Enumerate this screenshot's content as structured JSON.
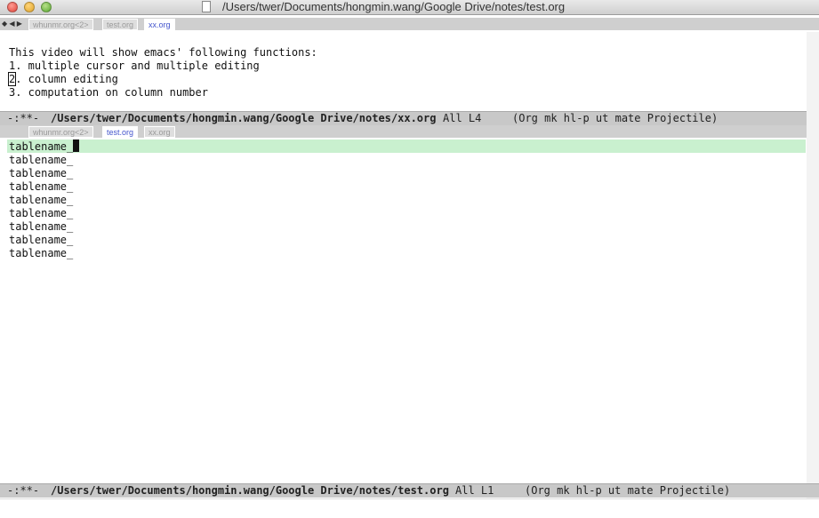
{
  "window": {
    "title": "/Users/twer/Documents/hongmin.wang/Google Drive/notes/test.org"
  },
  "top_tabs": {
    "nav": "◆ ◀ ▶",
    "tabs": [
      {
        "label": "whunmr.org<2>",
        "active": false
      },
      {
        "label": "test.org",
        "active": false
      },
      {
        "label": "xx.org",
        "active": true
      }
    ]
  },
  "top_buffer": {
    "lines": [
      "This video will show emacs' following functions:",
      "1. multiple cursor and multiple editing",
      "2. column editing",
      "3. computation on column number"
    ],
    "line3_first_char": "2",
    "line3_rest": ". column editing"
  },
  "top_modeline": {
    "status": "-:**-",
    "path": "/Users/twer/Documents/hongmin.wang/Google Drive/notes/xx.org",
    "position": "All L4",
    "modes": "(Org mk hl-p ut mate Projectile)"
  },
  "bottom_tabs": {
    "tabs": [
      {
        "label": "whunmr.org<2>",
        "active": false
      },
      {
        "label": "test.org",
        "active": true
      },
      {
        "label": "xx.org",
        "active": false
      }
    ]
  },
  "bottom_buffer": {
    "lines": [
      "tablename_",
      "tablename_",
      "tablename_",
      "tablename_",
      "tablename_",
      "tablename_",
      "tablename_",
      "tablename_",
      "tablename_"
    ]
  },
  "bottom_modeline": {
    "status": "-:**-",
    "path": "/Users/twer/Documents/hongmin.wang/Google Drive/notes/test.org",
    "position": "All L1",
    "modes": "(Org mk hl-p ut mate Projectile)"
  },
  "colors": {
    "highlight_line": "#c9f0cf",
    "modeline_bg": "#c8c8c8",
    "active_tab_text": "#4455cc"
  }
}
